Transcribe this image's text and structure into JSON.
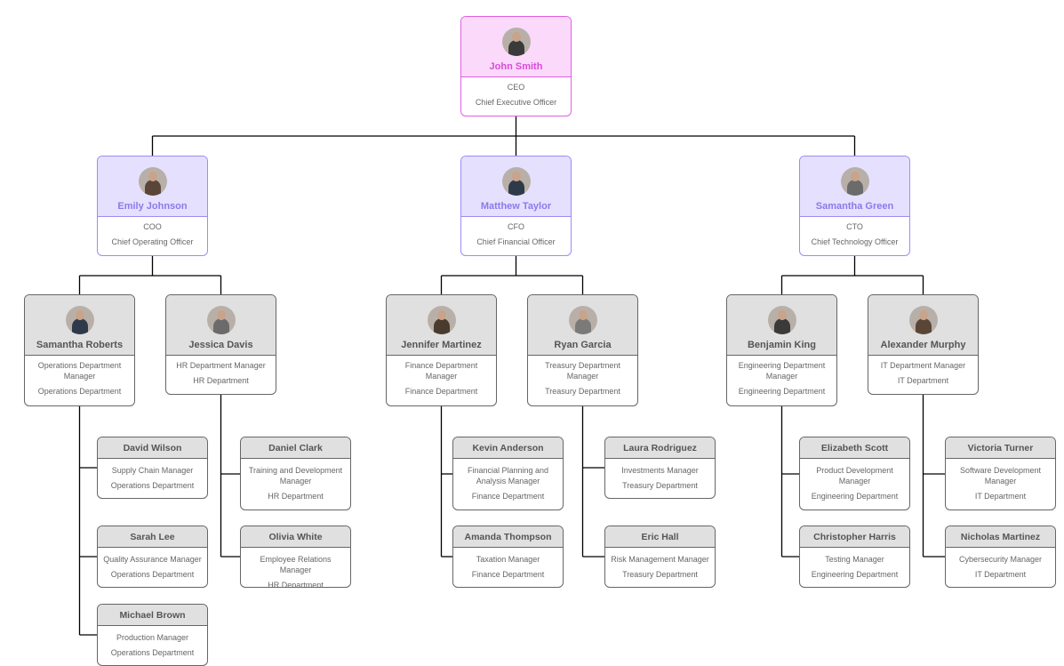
{
  "colors": {
    "ceo_border": "#e060e0",
    "ceo_fill": "#fbd9fb",
    "ceo_text": "#d94bd9",
    "exec_border": "#9d8cf5",
    "exec_fill": "#e5e0fd",
    "exec_text": "#8c79ee",
    "mgr_border": "#666666",
    "mgr_fill": "#e0e0e0",
    "connector": "#000000"
  },
  "chart": {
    "ceo": {
      "name": "John Smith",
      "title": "CEO",
      "role": "Chief Executive Officer",
      "avatar": "photo-icon"
    },
    "executives": [
      {
        "name": "Emily Johnson",
        "title": "COO",
        "role": "Chief Operating Officer",
        "avatar": "photo-icon"
      },
      {
        "name": "Matthew Taylor",
        "title": "CFO",
        "role": "Chief Financial Officer",
        "avatar": "photo-icon"
      },
      {
        "name": "Samantha Green",
        "title": "CTO",
        "role": "Chief Technology Officer",
        "avatar": "photo-icon"
      }
    ],
    "managers": [
      {
        "name": "Samantha Roberts",
        "title": "Operations Department Manager",
        "dept": "Operations Department"
      },
      {
        "name": "Jessica Davis",
        "title": "HR Department Manager",
        "dept": "HR Department"
      },
      {
        "name": "Jennifer Martinez",
        "title": "Finance Department Manager",
        "dept": "Finance Department"
      },
      {
        "name": "Ryan Garcia",
        "title": "Treasury Department Manager",
        "dept": "Treasury Department"
      },
      {
        "name": "Benjamin King",
        "title": "Engineering Department Manager",
        "dept": "Engineering Department"
      },
      {
        "name": "Alexander Murphy",
        "title": "IT Department Manager",
        "dept": "IT Department"
      }
    ],
    "staff": [
      {
        "name": "David Wilson",
        "title": "Supply Chain Manager",
        "dept": "Operations Department"
      },
      {
        "name": "Sarah Lee",
        "title": "Quality Assurance Manager",
        "dept": "Operations Department"
      },
      {
        "name": "Michael Brown",
        "title": "Production Manager",
        "dept": "Operations Department"
      },
      {
        "name": "Daniel Clark",
        "title": "Training and Development Manager",
        "dept": "HR Department"
      },
      {
        "name": "Olivia White",
        "title": "Employee Relations Manager",
        "dept": "HR Department"
      },
      {
        "name": "Kevin Anderson",
        "title": "Financial Planning and Analysis Manager",
        "dept": "Finance Department"
      },
      {
        "name": "Amanda Thompson",
        "title": "Taxation Manager",
        "dept": "Finance Department"
      },
      {
        "name": "Laura Rodriguez",
        "title": "Investments Manager",
        "dept": "Treasury Department"
      },
      {
        "name": "Eric Hall",
        "title": "Risk Management Manager",
        "dept": "Treasury Department"
      },
      {
        "name": "Elizabeth Scott",
        "title": "Product Development Manager",
        "dept": "Engineering Department"
      },
      {
        "name": "Christopher Harris",
        "title": "Testing Manager",
        "dept": "Engineering Department"
      },
      {
        "name": "Victoria Turner",
        "title": "Software Development Manager",
        "dept": "IT Department"
      },
      {
        "name": "Nicholas Martinez",
        "title": "Cybersecurity Manager",
        "dept": "IT Department"
      }
    ]
  }
}
